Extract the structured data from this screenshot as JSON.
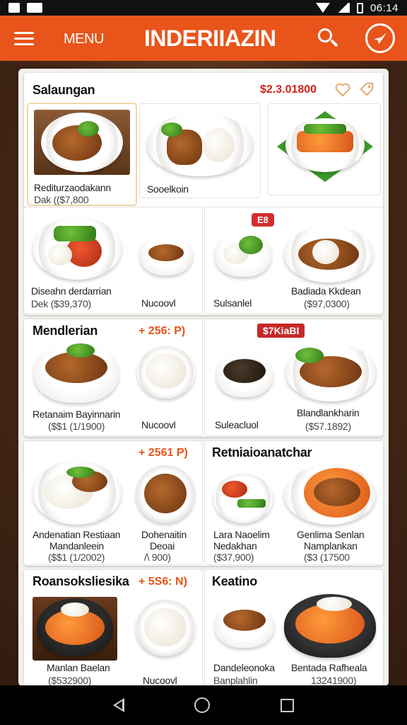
{
  "status_bar": {
    "time": "06:14"
  },
  "app_bar": {
    "menu_label": "MENU",
    "title": "INDERIIAZIN"
  },
  "sections": [
    {
      "title": "Salaungan",
      "price": "$2.3.01800",
      "items": [
        {
          "name": "Rediturzaodakann",
          "price": "Dak (($7,800"
        },
        {
          "name": "Sooelkoin",
          "price": ""
        },
        {
          "name": "",
          "price": ""
        }
      ]
    },
    {
      "badge": "E8",
      "items": [
        {
          "name": "Diseahn derdarrian",
          "price": "Dek ($39,370)"
        },
        {
          "name": "Nucoovl",
          "price": ""
        },
        {
          "name": "Sulsanlel",
          "price": ""
        },
        {
          "name": "Badiada Kkdean",
          "price": "($97,0300)"
        }
      ]
    },
    {
      "title": "Mendlerian",
      "price": "+ 256: P)",
      "badge": "$7KiaBI",
      "items": [
        {
          "name": "Retanaim Bayinnarin",
          "price": "($$1 (1/1900)"
        },
        {
          "name": "Nucoovl",
          "price": ""
        },
        {
          "name": "Suleacluol",
          "price": ""
        },
        {
          "name": "Blandlankharin",
          "price": "($57.1892)"
        }
      ]
    },
    {
      "title": "Retniaioanatchar",
      "price": "+ 2561 P)",
      "items": [
        {
          "name": "Andenatian Restiaan",
          "name2": "Mandanleein",
          "price": "($$1 (1/2002)"
        },
        {
          "name": "Dohenaitin",
          "name2": "Deoai",
          "price": "/\\ 900)"
        },
        {
          "name": "Lara Naoelim",
          "name2": "Nedakhan",
          "price": "($37,900)"
        },
        {
          "name": "Genlima Senlan",
          "name2": "Namplankan",
          "price": "($3 (17500"
        }
      ]
    },
    {
      "title": "Roansoksliesika",
      "price": "+ 5S6: N)",
      "title2": "Keatino",
      "items": [
        {
          "name": "Manlan Baelan",
          "price": "($532900)"
        },
        {
          "name": "Nucoovl",
          "price": ""
        },
        {
          "name": "Dandeleonoka",
          "price": "Banplahlin"
        },
        {
          "name": "Bentada Rafheala",
          "price": "13241900)"
        }
      ]
    }
  ],
  "colors": {
    "accent": "#e8541a",
    "badge": "#d32f2f"
  }
}
